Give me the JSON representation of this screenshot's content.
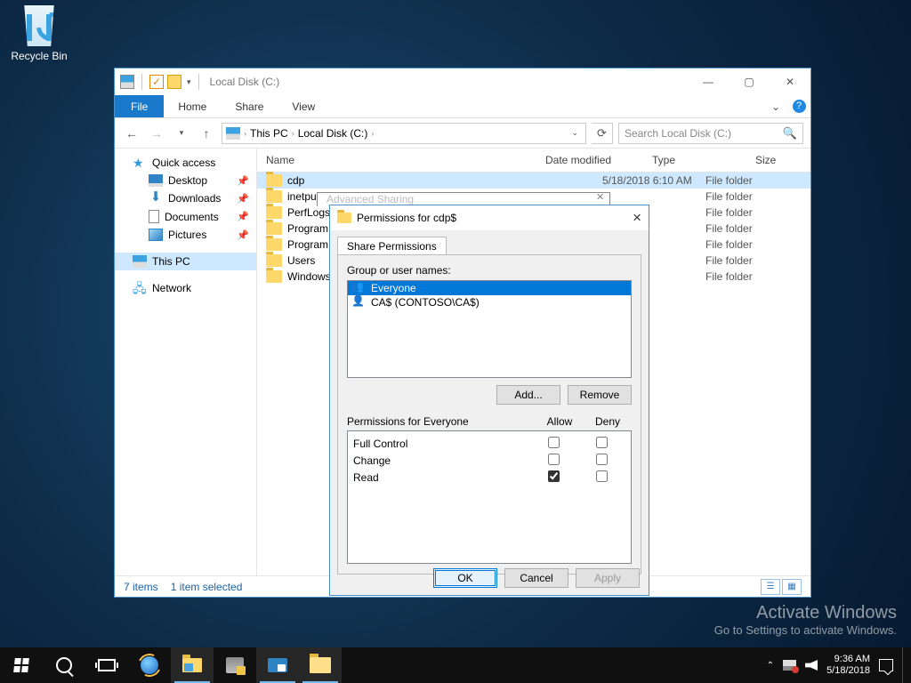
{
  "desktop": {
    "recycle_bin": "Recycle Bin"
  },
  "explorer": {
    "title": "Local Disk (C:)",
    "tabs": {
      "file": "File",
      "home": "Home",
      "share": "Share",
      "view": "View"
    },
    "breadcrumb": {
      "root": "This PC",
      "loc": "Local Disk (C:)"
    },
    "search_placeholder": "Search Local Disk (C:)",
    "columns": {
      "name": "Name",
      "date": "Date modified",
      "type": "Type",
      "size": "Size"
    },
    "rows": [
      {
        "name": "cdp",
        "date": "5/18/2018 6:10 AM",
        "type": "File folder"
      },
      {
        "name": "inetpub",
        "type": "File folder"
      },
      {
        "name": "PerfLogs",
        "type": "File folder"
      },
      {
        "name": "Program Files",
        "type": "File folder"
      },
      {
        "name": "Program Files (x86)",
        "type": "File folder"
      },
      {
        "name": "Users",
        "type": "File folder"
      },
      {
        "name": "Windows",
        "type": "File folder"
      }
    ],
    "sidebar": {
      "quick": "Quick access",
      "desktop": "Desktop",
      "downloads": "Downloads",
      "documents": "Documents",
      "pictures": "Pictures",
      "thispc": "This PC",
      "network": "Network"
    },
    "status": {
      "items": "7 items",
      "selected": "1 item selected"
    }
  },
  "advsharing": {
    "title": "Advanced Sharing"
  },
  "perm": {
    "title": "Permissions for cdp$",
    "tab": "Share Permissions",
    "group_label": "Group or user names:",
    "users": [
      {
        "name": "Everyone",
        "kind": "group"
      },
      {
        "name": "CA$ (CONTOSO\\CA$)",
        "kind": "single"
      }
    ],
    "add": "Add...",
    "remove": "Remove",
    "perm_for": "Permissions for Everyone",
    "allow": "Allow",
    "deny": "Deny",
    "rows": [
      {
        "label": "Full Control",
        "allow": false,
        "deny": false
      },
      {
        "label": "Change",
        "allow": false,
        "deny": false
      },
      {
        "label": "Read",
        "allow": true,
        "deny": false
      }
    ],
    "ok": "OK",
    "cancel": "Cancel",
    "apply": "Apply"
  },
  "watermark": {
    "l1": "Activate Windows",
    "l2": "Go to Settings to activate Windows."
  },
  "tray": {
    "time": "9:36 AM",
    "date": "5/18/2018"
  }
}
